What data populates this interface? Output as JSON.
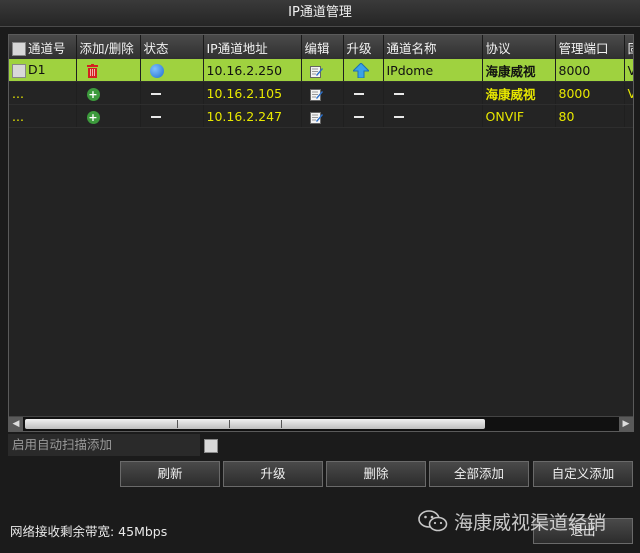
{
  "window": {
    "title": "IP通道管理"
  },
  "table": {
    "headers": [
      "通道号",
      "添加/删除",
      "状态",
      "IP通道地址",
      "编辑",
      "升级",
      "通道名称",
      "协议",
      "管理端口",
      "固"
    ],
    "rows": [
      {
        "channel": "D1",
        "ip": "10.16.2.250",
        "name": "IPdome",
        "protocol": "海康威视",
        "port": "8000",
        "extra": "V",
        "action_icon": "trash-icon",
        "status_icon": "status-online-icon",
        "upgrade_icon": "upgrade-arrow-icon"
      },
      {
        "channel": "...",
        "ip": "10.16.2.105",
        "name": "",
        "protocol": "海康威视",
        "port": "8000",
        "extra": "V",
        "action_icon": "add-icon",
        "status_icon": "dash",
        "upgrade_icon": "dash"
      },
      {
        "channel": "...",
        "ip": "10.16.2.247",
        "name": "",
        "protocol": "ONVIF",
        "port": "80",
        "extra": "",
        "action_icon": "add-icon",
        "status_icon": "dash",
        "upgrade_icon": "dash"
      }
    ]
  },
  "auto_scan": {
    "label": "启用自动扫描添加",
    "checked": false
  },
  "buttons": {
    "refresh": "刷新",
    "upgrade": "升级",
    "delete": "删除",
    "add_all": "全部添加",
    "custom_add": "自定义添加",
    "exit": "退出"
  },
  "status_bar": {
    "bandwidth": "网络接收剩余带宽: 45Mbps"
  },
  "watermark": {
    "text": "海康威视渠道经销"
  },
  "colors": {
    "selected_row": "#9fd23f",
    "row_text": "#e8e800",
    "background": "#1b1b1b"
  }
}
